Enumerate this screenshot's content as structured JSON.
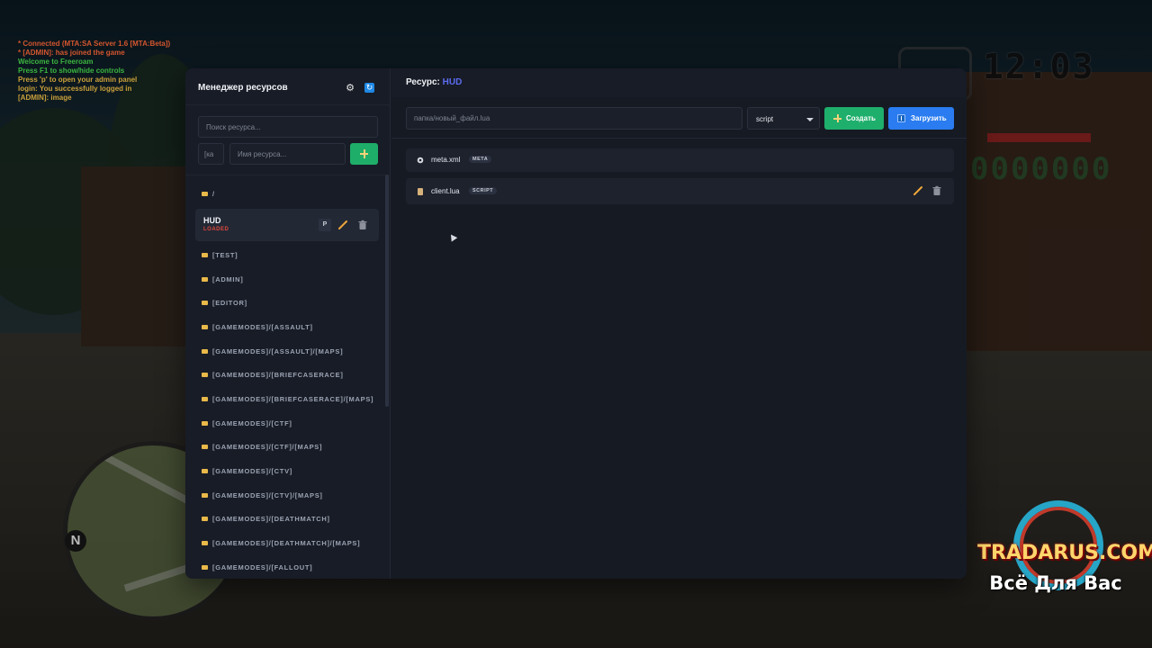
{
  "chat": [
    {
      "text": "* Connected (MTA:SA Server 1.6 [MTA:Beta])",
      "color": "#d3562f"
    },
    {
      "text": "* [ADMIN]: has joined the game",
      "color": "#d3562f"
    },
    {
      "text": "Welcome to Freeroam",
      "color": "#3bb640"
    },
    {
      "text": "Press F1 to show/hide controls",
      "color": "#3bb640"
    },
    {
      "text": "Press 'p' to open your admin panel",
      "color": "#c9a03b"
    },
    {
      "text": "login: You successfully logged in",
      "color": "#c9a03b"
    },
    {
      "text": "[ADMIN]: image",
      "color": "#c9a03b"
    }
  ],
  "hud": {
    "clock": "12:03",
    "money": "0000000"
  },
  "radar": {
    "north_label": "N"
  },
  "watermark": {
    "brand": "TRADARUS.COM",
    "slogan": "Всё Для Вас"
  },
  "sidebar": {
    "title": "Менеджер ресурсов",
    "search_placeholder": "Поиск ресурса...",
    "category_placeholder": "[ка",
    "name_placeholder": "Имя ресурса...",
    "root_folder": "/",
    "selected_resource": {
      "name": "HUD",
      "status": "LOADED",
      "status_color": "#e0493b",
      "p_label": "P"
    },
    "folders": [
      "[TEST]",
      "[ADMIN]",
      "[EDITOR]",
      "[GAMEMODES]/[ASSAULT]",
      "[GAMEMODES]/[ASSAULT]/[MAPS]",
      "[GAMEMODES]/[BRIEFCASERACE]",
      "[GAMEMODES]/[BRIEFCASERACE]/[MAPS]",
      "[GAMEMODES]/[CTF]",
      "[GAMEMODES]/[CTF]/[MAPS]",
      "[GAMEMODES]/[CTV]",
      "[GAMEMODES]/[CTV]/[MAPS]",
      "[GAMEMODES]/[DEATHMATCH]",
      "[GAMEMODES]/[DEATHMATCH]/[MAPS]",
      "[GAMEMODES]/[FALLOUT]"
    ]
  },
  "main": {
    "title_prefix": "Ресурс:",
    "title_resource": "HUD",
    "file_placeholder": "папка/новый_файл.lua",
    "type_select": "script",
    "create_label": "Создать",
    "upload_label": "Загрузить",
    "files": [
      {
        "name": "meta.xml",
        "badge": "META",
        "icon": "gear-icon"
      },
      {
        "name": "client.lua",
        "badge": "SCRIPT",
        "icon": "scroll-icon"
      }
    ]
  },
  "colors": {
    "accent_blue": "#2a7cf0",
    "accent_green": "#1faf6c",
    "resource_name": "#5b6cf0",
    "folder_icon": "#e9b949"
  }
}
